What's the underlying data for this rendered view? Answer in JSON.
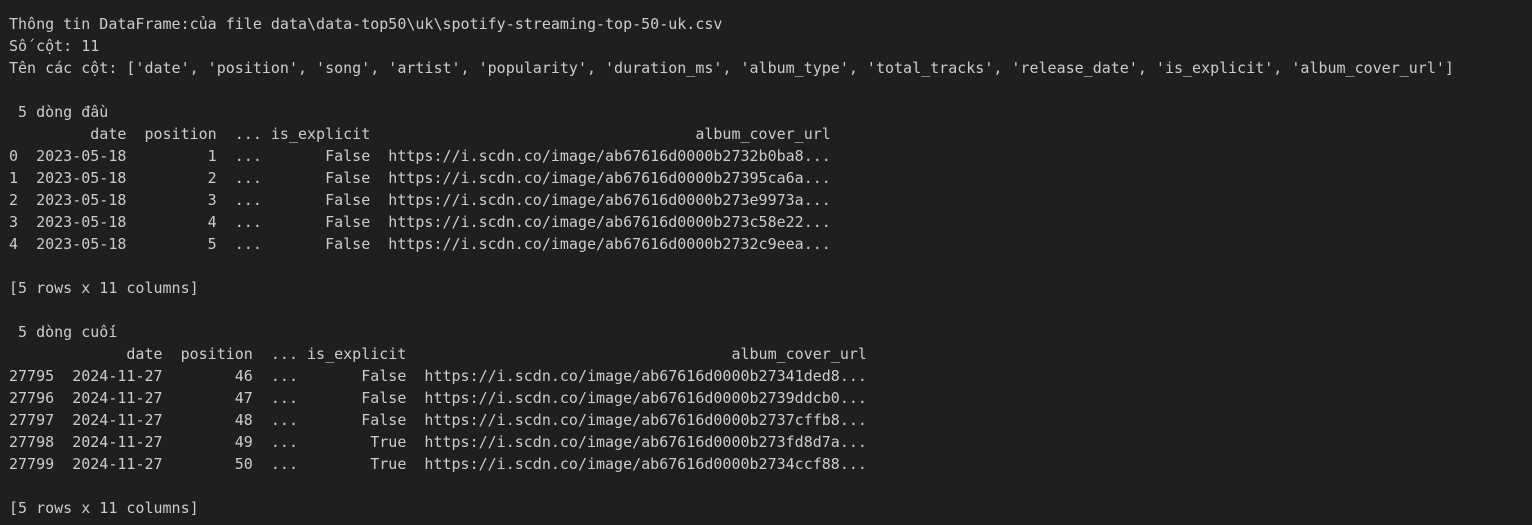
{
  "terminal": {
    "background": "#1f1f1f",
    "foreground": "#cccccc",
    "lines": [
      "Thông tin DataFrame:của file data\\data-top50\\uk\\spotify-streaming-top-50-uk.csv",
      "Số cột: 11",
      "Tên các cột: ['date', 'position', 'song', 'artist', 'popularity', 'duration_ms', 'album_type', 'total_tracks', 'release_date', 'is_explicit', 'album_cover_url']",
      "",
      " 5 dòng đầu",
      "         date  position  ... is_explicit                                    album_cover_url",
      "0  2023-05-18         1  ...       False  https://i.scdn.co/image/ab67616d0000b2732b0ba8...",
      "1  2023-05-18         2  ...       False  https://i.scdn.co/image/ab67616d0000b27395ca6a...",
      "2  2023-05-18         3  ...       False  https://i.scdn.co/image/ab67616d0000b273e9973a...",
      "3  2023-05-18         4  ...       False  https://i.scdn.co/image/ab67616d0000b273c58e22...",
      "4  2023-05-18         5  ...       False  https://i.scdn.co/image/ab67616d0000b2732c9eea...",
      "",
      "[5 rows x 11 columns]",
      "",
      " 5 dòng cuối",
      "             date  position  ... is_explicit                                    album_cover_url",
      "27795  2024-11-27        46  ...       False  https://i.scdn.co/image/ab67616d0000b27341ded8...",
      "27796  2024-11-27        47  ...       False  https://i.scdn.co/image/ab67616d0000b2739ddcb0...",
      "27797  2024-11-27        48  ...       False  https://i.scdn.co/image/ab67616d0000b2737cffb8...",
      "27798  2024-11-27        49  ...        True  https://i.scdn.co/image/ab67616d0000b273fd8d7a...",
      "27799  2024-11-27        50  ...        True  https://i.scdn.co/image/ab67616d0000b2734ccf88...",
      "",
      "[5 rows x 11 columns]"
    ]
  }
}
